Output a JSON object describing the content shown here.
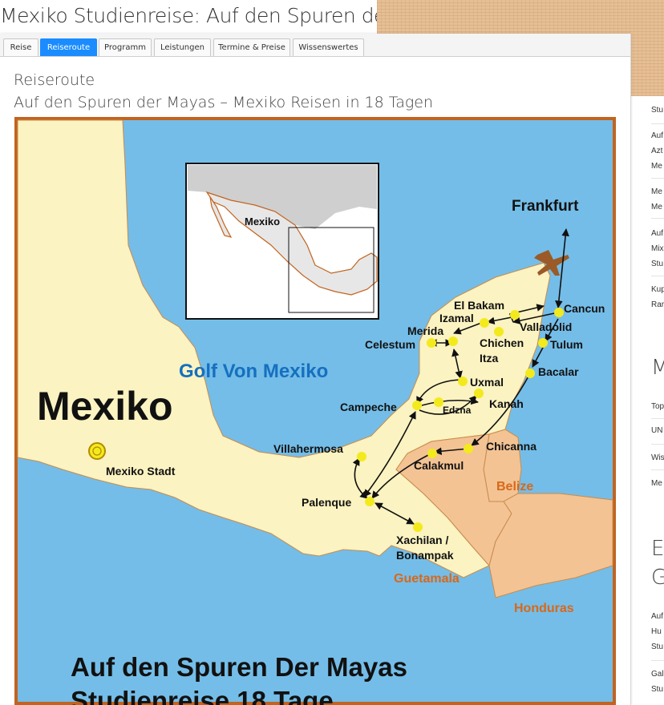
{
  "page": {
    "title": "Mexiko Studienreise: Auf den Spuren der Mayas"
  },
  "tabs": [
    {
      "label": "Reise",
      "active": false
    },
    {
      "label": "Reiseroute",
      "active": true
    },
    {
      "label": "Programm",
      "active": false
    },
    {
      "label": "Leistungen",
      "active": false
    },
    {
      "label": "Termine & Preise",
      "active": false
    },
    {
      "label": "Wissenswertes",
      "active": false
    }
  ],
  "content": {
    "heading": "Reiseroute",
    "subheading": "Auf den Spuren der Mayas – Mexiko Reisen in 18 Tagen"
  },
  "map": {
    "country_label": "Mexiko",
    "inset_label": "Mexiko",
    "sea_label": "Golf Von Mexiko",
    "capital_label": "Mexiko Stadt",
    "origin_label": "Frankfurt",
    "neighbors": {
      "belize": "Belize",
      "guatemala": "Guetamala",
      "honduras": "Honduras"
    },
    "places": {
      "cancun": "Cancun",
      "el_bakam": "El Bakam",
      "izamal": "Izamal",
      "valladolid": "Valladolid",
      "merida": "Merida",
      "chichen_itza_1": "Chichen",
      "chichen_itza_2": "Itza",
      "celestum": "Celestum",
      "tulum": "Tulum",
      "bacalar": "Bacalar",
      "uxmal": "Uxmal",
      "kanah": "Kanah",
      "campeche": "Campeche",
      "edzna": "Edzna",
      "chicanna": "Chicanna",
      "calakmul": "Calakmul",
      "villahermosa": "Villahermosa",
      "palenque": "Palenque",
      "xachilan_1": "Xachilan /",
      "xachilan_2": "Bonampak"
    },
    "caption_line1": "Auf den Spuren Der Mayas",
    "caption_line2": "Studienreise 18 Tage",
    "colors": {
      "sea": "#74bde8",
      "mexico": "#fbf3c1",
      "neighbors": "#f3c394",
      "frame": "#c2631e",
      "route_dot": "#f3ea1d",
      "sea_text": "#1570bf",
      "neighbor_text": "#d8681a"
    }
  },
  "sidebar": {
    "items": [
      {
        "text": "Stu"
      },
      {
        "text": "Auf"
      },
      {
        "text": "Azt"
      },
      {
        "text": "Me"
      },
      {
        "text": "Me"
      },
      {
        "text": "Me"
      },
      {
        "text": "Auf"
      },
      {
        "text": "Mix"
      },
      {
        "text": "Stu"
      },
      {
        "text": "Kup"
      },
      {
        "text": "Rar"
      }
    ],
    "heading1": "M",
    "items2": [
      {
        "text": "Top"
      },
      {
        "text": "UN"
      },
      {
        "text": "Wis"
      },
      {
        "text": "Me"
      }
    ],
    "heading2a": "E",
    "heading2b": "G",
    "items3": [
      {
        "text": "Auf"
      },
      {
        "text": "Hu"
      },
      {
        "text": "Stu"
      },
      {
        "text": "Gal"
      },
      {
        "text": "Stu"
      }
    ]
  }
}
